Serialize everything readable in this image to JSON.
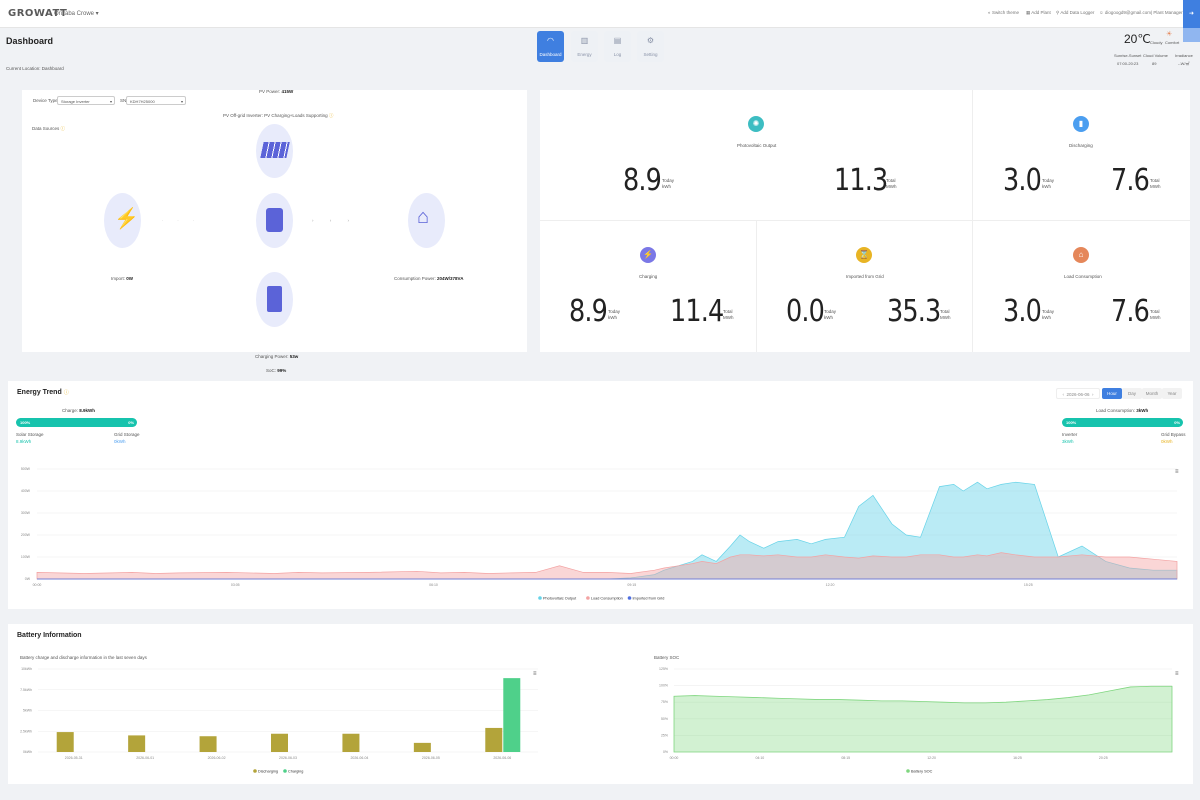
{
  "header": {
    "logo": "GROWATT",
    "plant_selector": "Orizaba Crowe",
    "links": [
      "Switch theme",
      "Add Plant",
      "Add Data Logger",
      "diogoogd9@gmail.com| Plant Manager"
    ]
  },
  "page": {
    "title": "Dashboard",
    "breadcrumb": "Current Location: Dashboard"
  },
  "nav": [
    {
      "label": "Dashboard",
      "icon": "gauge-icon",
      "active": true
    },
    {
      "label": "Energy",
      "icon": "bar-chart-icon",
      "active": false
    },
    {
      "label": "Log",
      "icon": "document-icon",
      "active": false
    },
    {
      "label": "Setting",
      "icon": "gear-icon",
      "active": false
    }
  ],
  "weather": {
    "temperature": "20℃",
    "condition": "Cloudy",
    "comfort": "Comfort",
    "sunrise_label": "Sunrise-Sunset",
    "sunrise_value": "07:00-20:23",
    "cloud_label": "Cloud Volume",
    "cloud_value": "89",
    "irradiance_label": "Irradiance",
    "irradiance_value": "--W/㎡"
  },
  "flow": {
    "device_type_label": "Device Type:",
    "device_type_value": "Storage Inverter",
    "sn_label": "SN:",
    "sn_value": "KDH7H25000",
    "data_sources": "Data Sources",
    "pv_power_label": "PV Power:",
    "pv_power_value": "415W",
    "mode_text": "PV Off-grid Inverter: PV Charging+Loads Supporting",
    "import_label": "Import:",
    "import_value": "0W",
    "consumption_label": "Consumption Power:",
    "consumption_value": "204W/378VA",
    "charging_label": "Charging Power:",
    "charging_value": "53w",
    "soc_label": "SoC:",
    "soc_value": "99%"
  },
  "stats": {
    "today": "Today",
    "total": "Total",
    "unit": "kWh",
    "unit_mwh": "MWh",
    "photovoltaic": {
      "title": "Photovoltaic Output",
      "today": "8.9",
      "total": "11.3",
      "color": "#3dbdc2"
    },
    "discharging": {
      "title": "Discharging",
      "today": "3.0",
      "total": "7.6",
      "color": "#4b9ef0"
    },
    "charging": {
      "title": "Charging",
      "today": "8.9",
      "total": "11.4",
      "color": "#7b78e6"
    },
    "imported": {
      "title": "Imported from Grid",
      "today": "0.0",
      "total": "35.3",
      "color": "#e8b424"
    },
    "load": {
      "title": "Load Consumption",
      "today": "3.0",
      "total": "7.6",
      "color": "#e5875a"
    }
  },
  "trend": {
    "title": "Energy Trend",
    "date": "2026-06-06",
    "buttons": [
      "Hour",
      "Day",
      "Month",
      "Year"
    ],
    "charge_label": "Charge:",
    "charge_value": "8.9kWh",
    "left_bar_left": "100%",
    "left_bar_right": "0%",
    "solar_storage_label": "Solar Storage",
    "solar_storage_value": "8.9kWh",
    "grid_storage_label": "Grid Storage",
    "grid_storage_value": "0kWh",
    "load_label": "Load Consumption:",
    "load_value": "3kWh",
    "right_bar_left": "100%",
    "right_bar_right": "0%",
    "inverter_label": "Inverter",
    "inverter_value": "3kWh",
    "grid_bypass_label": "Grid Bypass",
    "grid_bypass_value": "0kWh"
  },
  "battery": {
    "title": "Battery Information",
    "left_subtitle": "Battery charge and discharge information in the last seven days",
    "right_subtitle": "Battery SOC"
  },
  "chart_data": [
    {
      "type": "area",
      "title": "Energy Trend",
      "x_ticks": [
        "00:00",
        "03:05",
        "06:10",
        "09:15",
        "12:20",
        "15:25"
      ],
      "y_ticks": [
        "0W",
        "100W",
        "200W",
        "300W",
        "400W",
        "500W"
      ],
      "ylim": [
        0,
        500
      ],
      "legend_position": "bottom",
      "x": [
        0,
        1,
        2,
        2.5,
        3,
        4,
        5,
        5.5,
        6,
        7,
        8,
        8.5,
        9,
        9.5,
        10,
        10.5,
        11,
        11.5,
        12,
        12.5,
        13,
        13.2,
        13.5,
        13.8,
        14,
        14.3,
        14.6,
        14.8,
        15,
        15.3,
        15.6,
        16,
        16.3,
        16.6,
        17,
        17.3,
        17.6,
        18,
        18.3,
        18.6,
        19,
        19.3,
        19.5,
        19.8,
        20,
        20.3,
        20.6,
        21,
        21.5,
        22,
        22.5,
        23,
        23.5,
        24
      ],
      "series": [
        {
          "name": "Photovoltaic Output",
          "color": "#66d3e8",
          "values": [
            0,
            0,
            0,
            0,
            0,
            0,
            0,
            0,
            0,
            0,
            0,
            0,
            0,
            0,
            0,
            0,
            0,
            0,
            0,
            5,
            20,
            40,
            60,
            80,
            110,
            80,
            150,
            200,
            170,
            140,
            170,
            180,
            160,
            180,
            190,
            330,
            380,
            250,
            200,
            190,
            420,
            430,
            400,
            440,
            410,
            430,
            440,
            430,
            100,
            150,
            80,
            50,
            40,
            40
          ]
        },
        {
          "name": "Load Consumption",
          "color": "#f3a3a3",
          "values": [
            30,
            25,
            30,
            25,
            28,
            30,
            25,
            30,
            28,
            30,
            35,
            28,
            30,
            25,
            28,
            30,
            60,
            30,
            30,
            25,
            40,
            50,
            60,
            70,
            80,
            70,
            100,
            110,
            110,
            105,
            110,
            100,
            100,
            110,
            100,
            95,
            105,
            100,
            100,
            110,
            110,
            100,
            100,
            110,
            105,
            120,
            110,
            100,
            100,
            110,
            100,
            100,
            90,
            80
          ]
        },
        {
          "name": "Imported from Grid",
          "color": "#4f6fe0",
          "values": [
            0,
            0,
            0,
            0,
            0,
            0,
            0,
            0,
            0,
            0,
            0,
            0,
            0,
            0,
            0,
            0,
            0,
            0,
            0,
            0,
            0,
            0,
            0,
            0,
            0,
            0,
            0,
            0,
            0,
            0,
            0,
            0,
            0,
            0,
            0,
            0,
            0,
            0,
            0,
            0,
            0,
            0,
            0,
            0,
            0,
            0,
            0,
            0,
            0,
            0,
            0,
            0,
            0,
            0
          ]
        }
      ]
    },
    {
      "type": "bar",
      "title": "Battery charge and discharge information in the last seven days",
      "categories": [
        "2026-05-31",
        "2026-06-01",
        "2026-06-02",
        "2026-06-03",
        "2026-06-04",
        "2026-06-05",
        "2026-06-06"
      ],
      "y_ticks": [
        "0kWh",
        "2.5kWh",
        "5kWh",
        "7.5kWh",
        "10kWh"
      ],
      "ylim": [
        0,
        10
      ],
      "legend_position": "bottom",
      "series": [
        {
          "name": "Discharging",
          "color": "#b3a43a",
          "values": [
            2.4,
            2.0,
            1.9,
            2.2,
            2.2,
            1.1,
            2.9
          ]
        },
        {
          "name": "Charging",
          "color": "#4fd08a",
          "values": [
            0,
            0,
            0,
            0,
            0,
            0,
            8.9
          ]
        }
      ]
    },
    {
      "type": "area",
      "title": "Battery SOC",
      "x_ticks": [
        "00:00",
        "04:10",
        "08:15",
        "12:20",
        "16:25",
        "20:25"
      ],
      "y_ticks": [
        "0%",
        "25%",
        "50%",
        "75%",
        "100%",
        "125%"
      ],
      "ylim": [
        0,
        125
      ],
      "legend_position": "bottom",
      "series": [
        {
          "name": "Battery SOC",
          "color": "#7fd67f",
          "values": [
            84,
            85,
            84,
            83,
            82,
            81,
            80,
            79,
            79,
            78,
            77,
            77,
            76,
            75,
            74,
            74,
            75,
            77,
            79,
            82,
            86,
            92,
            98,
            99,
            99
          ]
        }
      ]
    }
  ]
}
